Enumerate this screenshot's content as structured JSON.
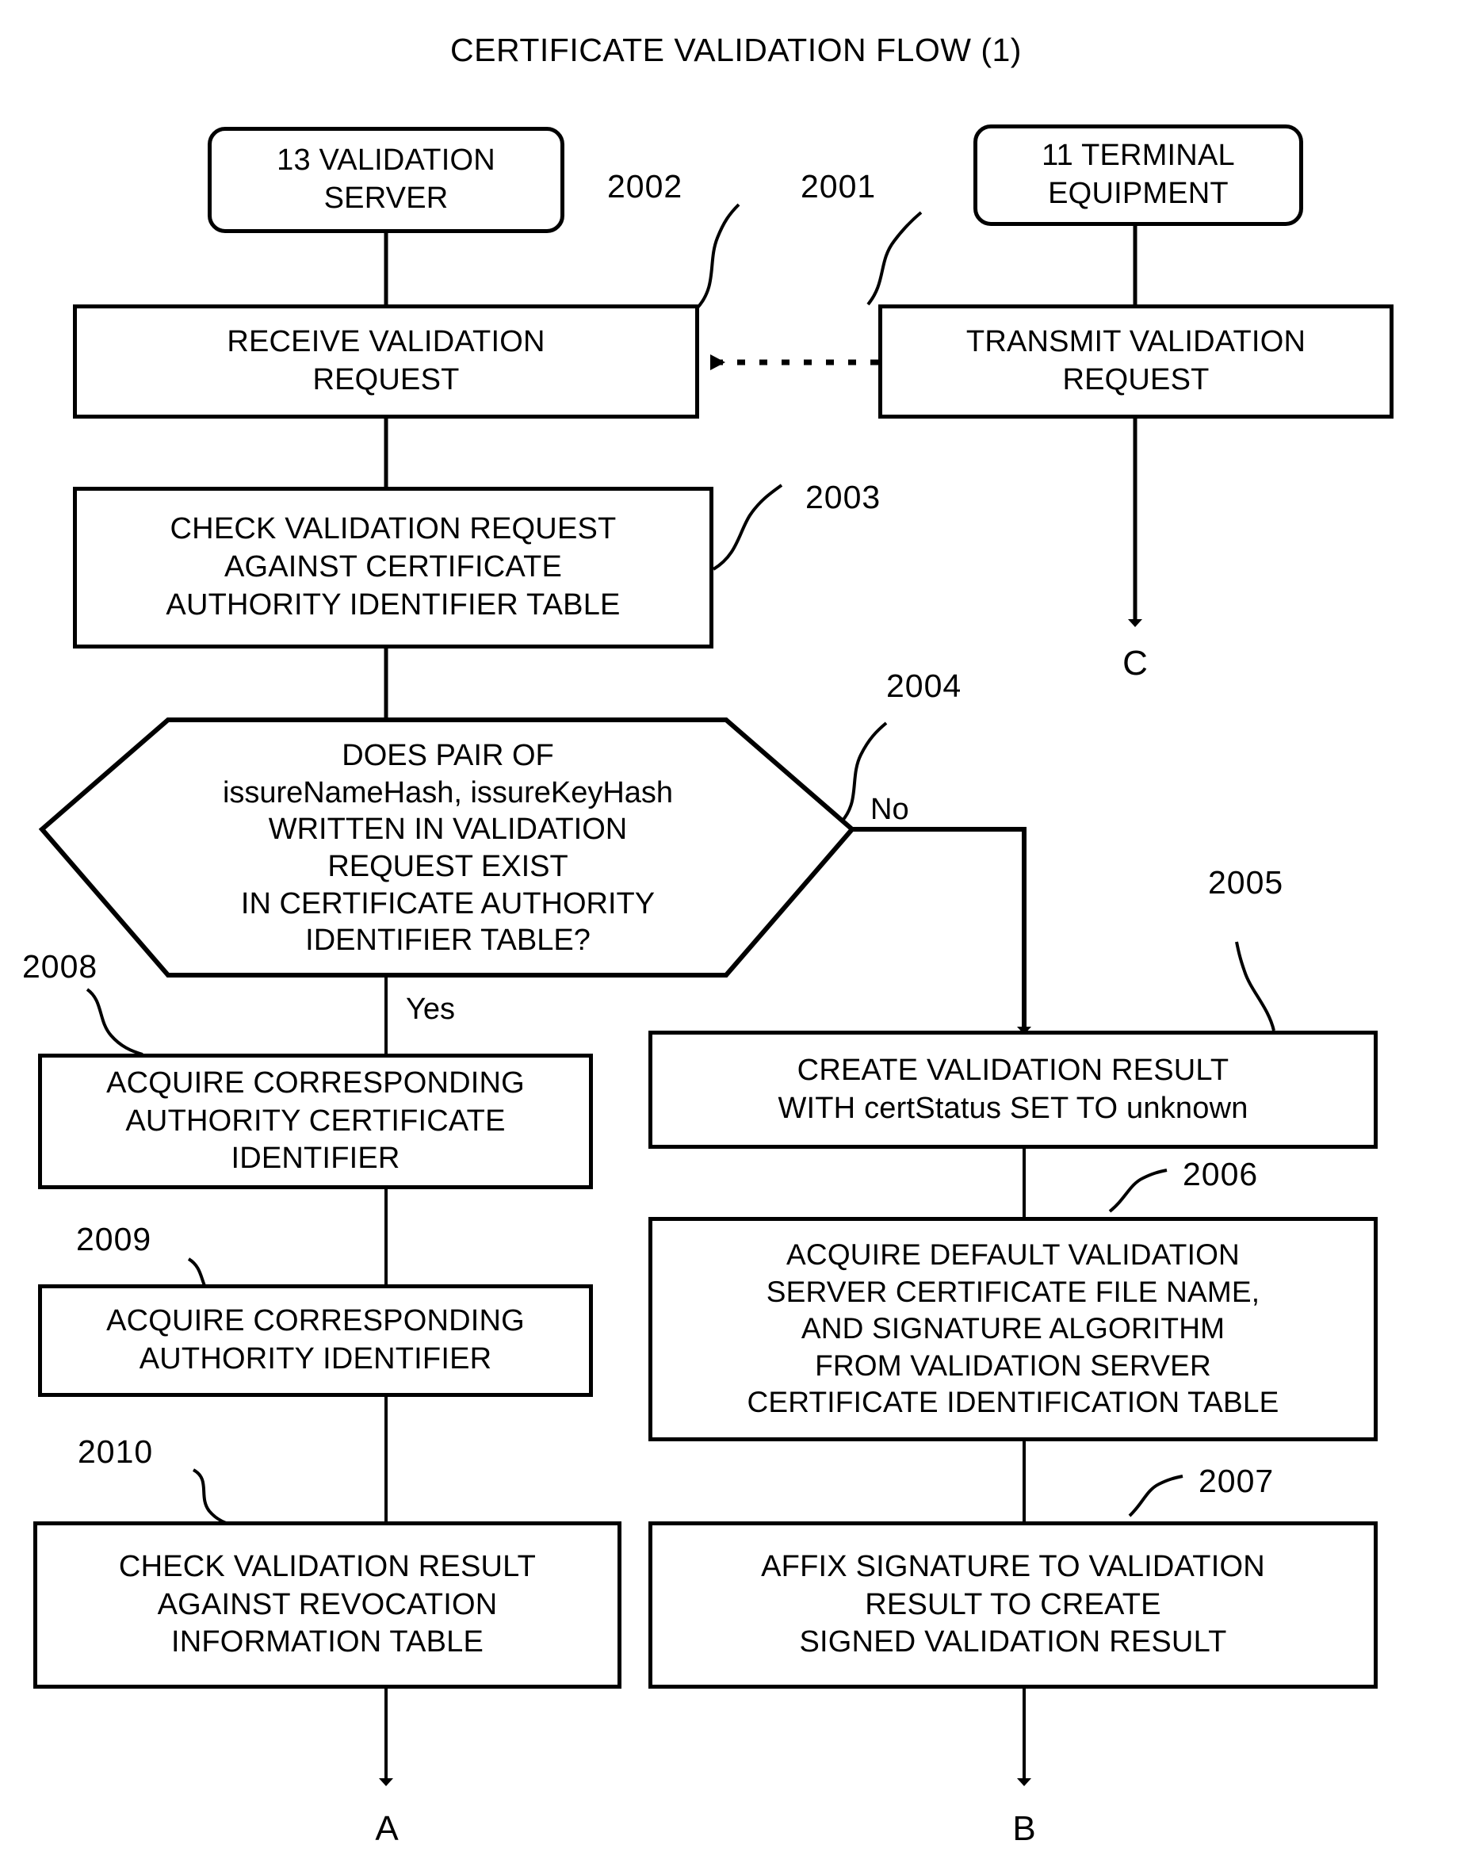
{
  "figure": {
    "title": "CERTIFICATE VALIDATION FLOW (1)"
  },
  "actors": {
    "validation_server": {
      "line1": "13 VALIDATION",
      "line2": "SERVER"
    },
    "terminal_equipment": {
      "line1": "11 TERMINAL",
      "line2": "EQUIPMENT"
    }
  },
  "nodes": {
    "receive_request": {
      "line1": "RECEIVE VALIDATION",
      "line2": "REQUEST"
    },
    "transmit_request": {
      "line1": "TRANSMIT VALIDATION",
      "line2": "REQUEST"
    },
    "check_request": {
      "line1": "CHECK VALIDATION REQUEST",
      "line2": "AGAINST CERTIFICATE",
      "line3": "AUTHORITY IDENTIFIER TABLE"
    },
    "decision": {
      "line1": "DOES PAIR OF",
      "line2": "issureNameHash, issureKeyHash",
      "line3": "WRITTEN IN VALIDATION",
      "line4": "REQUEST EXIST",
      "line5": "IN CERTIFICATE AUTHORITY",
      "line6": "IDENTIFIER TABLE?"
    },
    "acquire_auth_cert_id": {
      "line1": "ACQUIRE CORRESPONDING",
      "line2": "AUTHORITY CERTIFICATE",
      "line3": "IDENTIFIER"
    },
    "acquire_auth_id": {
      "line1": "ACQUIRE CORRESPONDING",
      "line2": "AUTHORITY IDENTIFIER"
    },
    "check_revocation": {
      "line1": "CHECK VALIDATION RESULT",
      "line2": "AGAINST REVOCATION",
      "line3": "INFORMATION TABLE"
    },
    "create_result_unknown": {
      "line1": "CREATE VALIDATION RESULT",
      "line2": "WITH certStatus SET TO unknown"
    },
    "acquire_default_cert": {
      "line1": "ACQUIRE DEFAULT VALIDATION",
      "line2": "SERVER CERTIFICATE FILE NAME,",
      "line3": "AND SIGNATURE ALGORITHM",
      "line4": "FROM VALIDATION SERVER",
      "line5": "CERTIFICATE IDENTIFICATION TABLE"
    },
    "affix_signature": {
      "line1": "AFFIX SIGNATURE TO VALIDATION",
      "line2": "RESULT TO CREATE",
      "line3": "SIGNED VALIDATION RESULT"
    }
  },
  "refs": {
    "r2001": "2001",
    "r2002": "2002",
    "r2003": "2003",
    "r2004": "2004",
    "r2005": "2005",
    "r2006": "2006",
    "r2007": "2007",
    "r2008": "2008",
    "r2009": "2009",
    "r2010": "2010"
  },
  "branches": {
    "yes": "Yes",
    "no": "No"
  },
  "connectors": {
    "a": "A",
    "b": "B",
    "c": "C"
  },
  "colors": {
    "stroke": "#000000",
    "background": "#ffffff"
  }
}
